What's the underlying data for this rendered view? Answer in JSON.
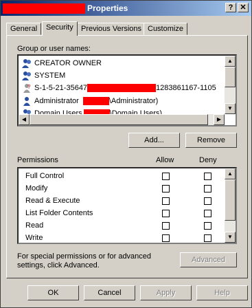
{
  "window": {
    "title": "Properties",
    "help_button": "?",
    "close_button": "✕"
  },
  "tabs": [
    "General",
    "Security",
    "Previous Versions",
    "Customize"
  ],
  "group_label": "Group or user names:",
  "users": [
    {
      "name": "CREATOR OWNER",
      "icon": "group-icon"
    },
    {
      "name": "SYSTEM",
      "icon": "group-icon"
    },
    {
      "name_prefix": "S-1-5-21-35647",
      "name_suffix": "1283861167-1105",
      "icon": "unknown-user-icon"
    },
    {
      "name_prefix": "Administrator",
      "name_suffix": "\\Administrator)",
      "icon": "user-icon"
    },
    {
      "name_prefix": "Domain Users",
      "name_suffix": "\\Domain Users)",
      "icon": "group-icon"
    }
  ],
  "buttons": {
    "add": "Add...",
    "remove": "Remove",
    "advanced": "Advanced",
    "ok": "OK",
    "cancel": "Cancel",
    "apply": "Apply",
    "help": "Help"
  },
  "permissions": {
    "label": "Permissions",
    "allow_label": "Allow",
    "deny_label": "Deny",
    "items": [
      "Full Control",
      "Modify",
      "Read & Execute",
      "List Folder Contents",
      "Read",
      "Write"
    ]
  },
  "advanced_note": "For special permissions or for advanced settings, click Advanced.",
  "colors": {
    "redaction": "#ff0000",
    "titlebar_start": "#0a246a",
    "titlebar_end": "#a6caf0"
  }
}
